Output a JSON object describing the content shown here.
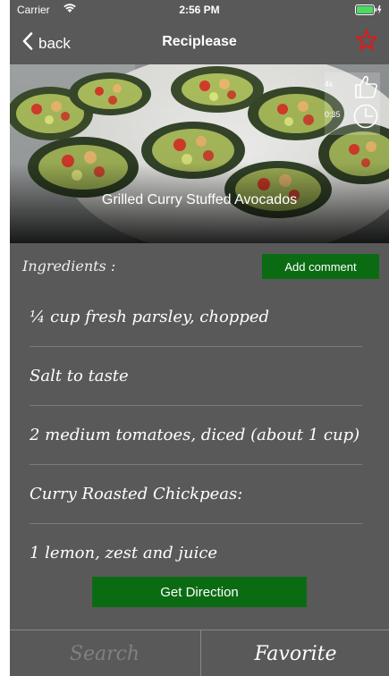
{
  "status": {
    "carrier": "Carrier",
    "time": "2:56 PM"
  },
  "nav": {
    "back_label": "back",
    "title": "Reciplease"
  },
  "recipe": {
    "name": "Grilled Curry Stuffed Avocados",
    "likes": "4k",
    "duration": "0:35"
  },
  "ingredients_title": "Ingredients :",
  "add_comment_label": "Add comment",
  "ingredients": [
    "¼ cup fresh parsley, chopped",
    "Salt to taste",
    "2 medium tomatoes, diced (about 1 cup)",
    "Curry Roasted Chickpeas:",
    "1 lemon, zest and juice"
  ],
  "get_direction_label": "Get Direction",
  "tabs": {
    "search": "Search",
    "favorite": "Favorite"
  },
  "colors": {
    "accent_green": "#0b6b13",
    "star_red": "#e0191b",
    "background": "#595959"
  }
}
